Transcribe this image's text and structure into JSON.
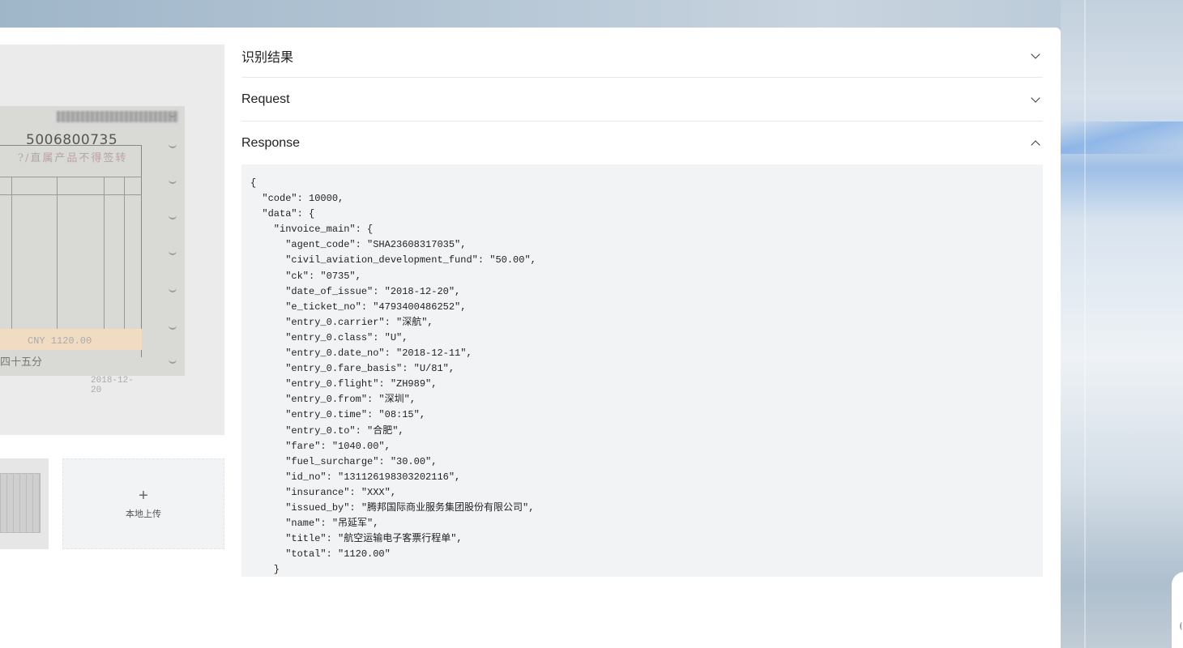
{
  "sections": [
    {
      "title": "识别结果",
      "expanded": false
    },
    {
      "title": "Request",
      "expanded": false
    },
    {
      "title": "Response",
      "expanded": true
    }
  ],
  "upload": {
    "plus": "+",
    "label": "本地上传"
  },
  "ticket_image": {
    "number": "5006800735",
    "stamp_text": "?/直属产品不得签转",
    "total_text": "CNY 1120.00",
    "bottom_text": "四十五分",
    "date_text": "2018-12-20"
  },
  "response_json": "{\n  \"code\": 10000,\n  \"data\": {\n    \"invoice_main\": {\n      \"agent_code\": \"SHA23608317035\",\n      \"civil_aviation_development_fund\": \"50.00\",\n      \"ck\": \"0735\",\n      \"date_of_issue\": \"2018-12-20\",\n      \"e_ticket_no\": \"4793400486252\",\n      \"entry_0.carrier\": \"深航\",\n      \"entry_0.class\": \"U\",\n      \"entry_0.date_no\": \"2018-12-11\",\n      \"entry_0.fare_basis\": \"U/81\",\n      \"entry_0.flight\": \"ZH989\",\n      \"entry_0.from\": \"深圳\",\n      \"entry_0.time\": \"08:15\",\n      \"entry_0.to\": \"合肥\",\n      \"fare\": \"1040.00\",\n      \"fuel_surcharge\": \"30.00\",\n      \"id_no\": \"131126198303202116\",\n      \"insurance\": \"XXX\",\n      \"issued_by\": \"腾邦国际商业服务集团股份有限公司\",\n      \"name\": \"吊延军\",\n      \"title\": \"航空运输电子客票行程单\",\n      \"total\": \"1120.00\"\n    }",
  "colors": {
    "panel_bg": "#ffffff",
    "code_bg": "#f2f3f5",
    "upload_bg": "#f2f3f5",
    "preview_bg": "#ebebeb"
  }
}
